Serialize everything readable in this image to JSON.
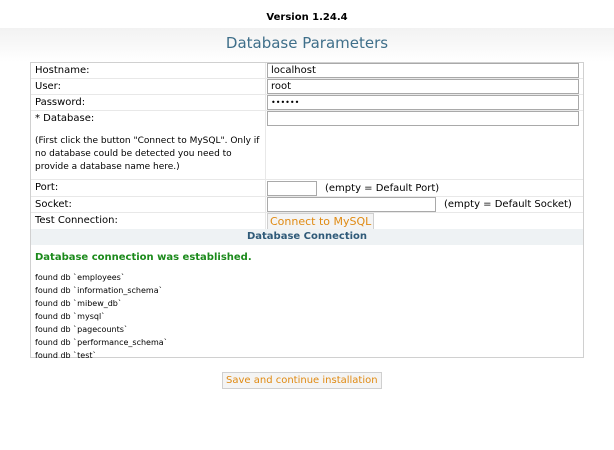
{
  "header": {
    "version": "Version 1.24.4",
    "title": "Database Parameters"
  },
  "form": {
    "hostname_label": "Hostname:",
    "hostname_value": "localhost",
    "user_label": "User:",
    "user_value": "root",
    "password_label": "Password:",
    "password_value": "••••••",
    "database_label": "* Database:",
    "database_value": "",
    "database_note": "(First click the button \"Connect to MySQL\". Only if no database could be detected you need to provide a database name here.)",
    "port_label": "Port:",
    "port_value": "",
    "port_hint": "(empty = Default Port)",
    "socket_label": "Socket:",
    "socket_value": "",
    "socket_hint": "(empty = Default Socket)",
    "test_label": "Test Connection:",
    "connect_button": "Connect to MySQL"
  },
  "connection": {
    "heading": "Database Connection",
    "status": "Database connection was established.",
    "databases": [
      "found db `employees`",
      "found db `information_schema`",
      "found db `mibew_db`",
      "found db `mysql`",
      "found db `pagecounts`",
      "found db `performance_schema`",
      "found db `test`"
    ]
  },
  "footer": {
    "save_button": "Save and continue installation"
  },
  "colors": {
    "title": "#3f6f8a",
    "button_text": "#e08a12",
    "success": "#1b8a1b",
    "section_header_bg": "#eef2f4"
  }
}
